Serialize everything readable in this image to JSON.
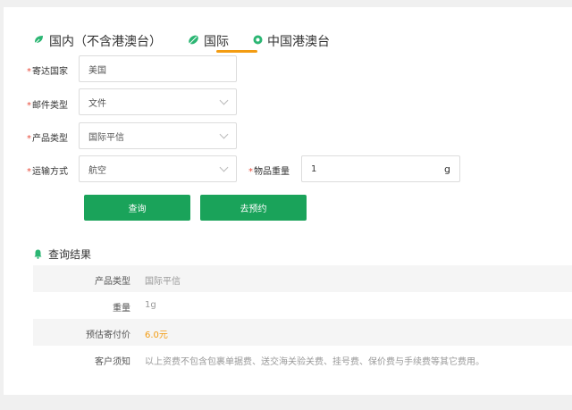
{
  "tabs": [
    {
      "label": "国内（不含港澳台）",
      "icon": "leaf-icon",
      "active": false
    },
    {
      "label": "国际",
      "icon": "leaf-icon",
      "active": true
    },
    {
      "label": "中国港澳台",
      "icon": "dot-icon",
      "active": false
    }
  ],
  "form": {
    "required_mark": "*",
    "destination": {
      "label": "寄达国家",
      "value": "美国"
    },
    "mail_type": {
      "label": "邮件类型",
      "value": "文件"
    },
    "product_type": {
      "label": "产品类型",
      "value": "国际平信"
    },
    "transport": {
      "label": "运输方式",
      "value": "航空"
    },
    "weight": {
      "label": "物品重量",
      "value": "1",
      "unit": "g"
    }
  },
  "buttons": {
    "query": "查询",
    "book": "去预约"
  },
  "result": {
    "title": "查询结果",
    "rows": [
      {
        "key": "产品类型",
        "value": "国际平信"
      },
      {
        "key": "重量",
        "value": "1g"
      },
      {
        "key": "预估寄付价",
        "value": "6.0元"
      },
      {
        "key": "客户须知",
        "value": "以上资费不包含包裹单据费、送交海关验关费、挂号费、保价费与手续费等其它费用。"
      }
    ]
  },
  "colors": {
    "accent": "#f39c12",
    "button": "#1aa35a",
    "required": "#e74c3c"
  }
}
